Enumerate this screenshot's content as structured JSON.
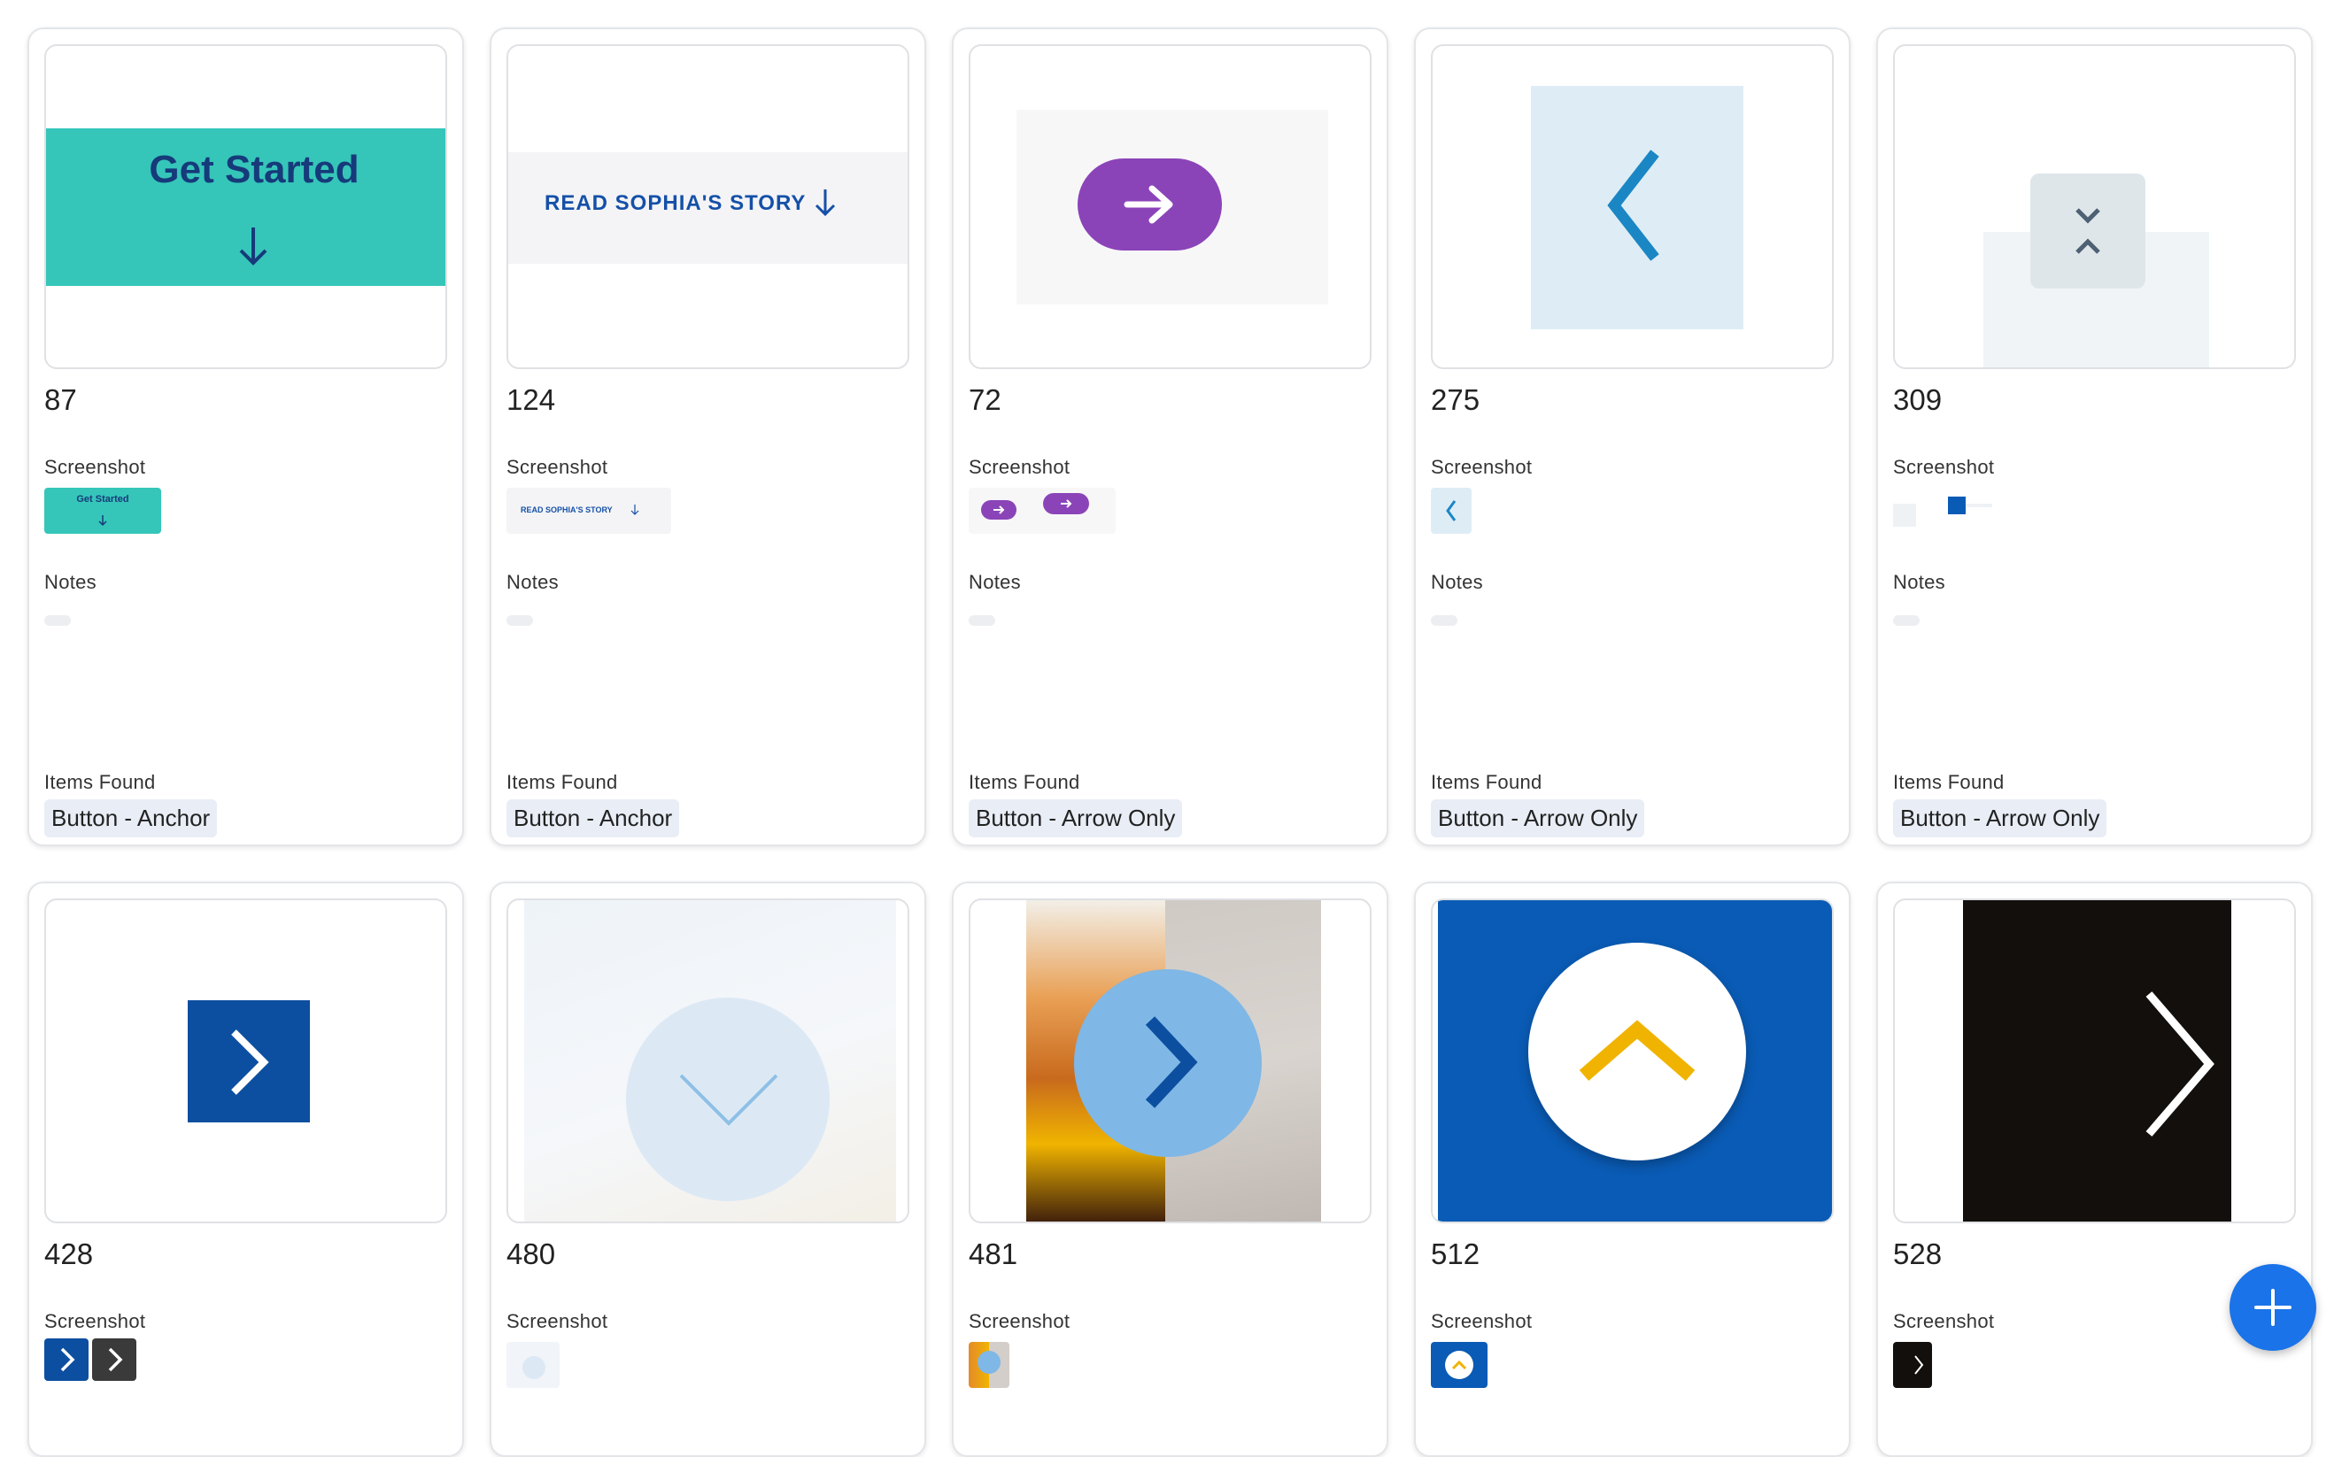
{
  "labels": {
    "screenshot": "Screenshot",
    "notes": "Notes",
    "items_found": "Items Found"
  },
  "colors": {
    "teal": "#35c6b9",
    "navy": "#163a7a",
    "purple": "#8b44b8",
    "light_blue": "#deedf5",
    "arrow_blue": "#1b86c4",
    "blue": "#0a5bb5",
    "dark_blue": "#0c4fa0",
    "yellow": "#f0b400",
    "black": "#120f0c",
    "fab_blue": "#1a73e8"
  },
  "cards": [
    {
      "id": "87",
      "preview_text": "Get Started",
      "thumb_text": "Get Started",
      "tag": "Button - Anchor"
    },
    {
      "id": "124",
      "preview_text": "READ SOPHIA'S STORY",
      "thumb_text": "READ SOPHIA'S STORY",
      "tag": "Button - Anchor"
    },
    {
      "id": "72",
      "tag": "Button - Arrow Only"
    },
    {
      "id": "275",
      "tag": "Button - Arrow Only"
    },
    {
      "id": "309",
      "tag": "Button - Arrow Only"
    },
    {
      "id": "428"
    },
    {
      "id": "480"
    },
    {
      "id": "481"
    },
    {
      "id": "512"
    },
    {
      "id": "528"
    }
  ],
  "fab": {
    "icon": "plus-icon"
  }
}
